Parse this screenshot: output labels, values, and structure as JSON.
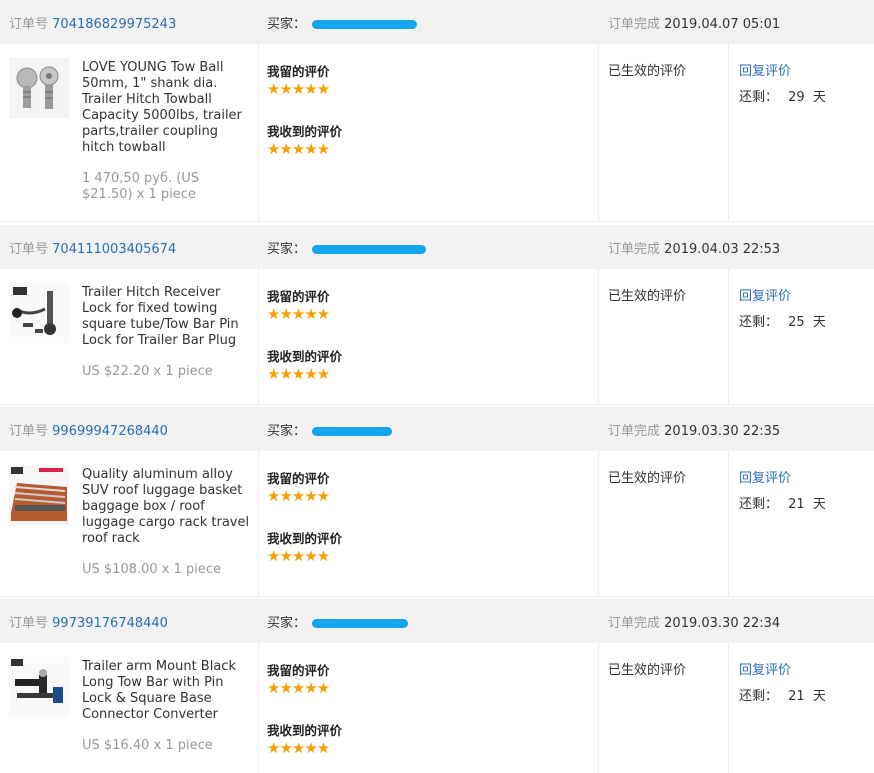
{
  "labels": {
    "order_no": "订单号",
    "buyer": "买家：",
    "completed": "订单完成",
    "my_review": "我留的评价",
    "received_review": "我收到的评价",
    "status": "已生效的评价",
    "reply": "回复评价",
    "remaining_prefix": "还剩：",
    "day_unit": "天"
  },
  "stars": "★★★★★",
  "orders": [
    {
      "order_no": "704186829975243",
      "completed_at": "2019.04.07 05:01",
      "title": "LOVE YOUNG Tow Ball 50mm, 1\" shank dia. Trailer Hitch Towball Capacity 5000lbs, trailer parts,trailer coupling hitch towball",
      "price": "1 470,50 руб. (US $21.50) x 1 piece",
      "days_left": "29",
      "image": "tow-ball-thumbnail",
      "rating_my": 5,
      "rating_received": 5
    },
    {
      "order_no": "704111003405674",
      "completed_at": "2019.04.03 22:53",
      "title": "Trailer Hitch Receiver Lock for fixed towing square tube/Tow Bar Pin Lock for Trailer Bar Plug",
      "price": "US $22.20 x 1 piece",
      "days_left": "25",
      "image": "hitch-lock-thumbnail",
      "rating_my": 5,
      "rating_received": 5
    },
    {
      "order_no": "99699947268440",
      "completed_at": "2019.03.30 22:35",
      "title": "Quality aluminum alloy SUV roof luggage basket baggage box / roof luggage cargo rack travel roof rack",
      "price": "US $108.00 x 1 piece",
      "days_left": "21",
      "image": "roof-rack-thumbnail",
      "rating_my": 5,
      "rating_received": 5
    },
    {
      "order_no": "99739176748440",
      "completed_at": "2019.03.30 22:34",
      "title": "Trailer arm Mount Black Long Tow Bar with Pin Lock & Square Base Connector Converter",
      "price": "US $16.40 x 1 piece",
      "days_left": "21",
      "image": "tow-bar-thumbnail",
      "rating_my": 5,
      "rating_received": 5
    }
  ],
  "colors": {
    "link": "#2a6ebb",
    "star": "#f5a000",
    "header_bg": "#f2f2f2",
    "redaction": "#12a6f0"
  }
}
